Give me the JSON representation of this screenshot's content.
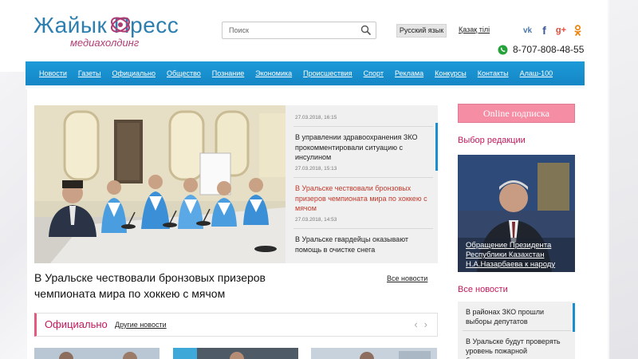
{
  "header": {
    "logo_title": "Жайык Пресс",
    "logo_subtitle": "медиахолдинг",
    "search_placeholder": "Поиск",
    "lang_ru": "Русский язык",
    "lang_kz": "Қазақ тілі",
    "social_icons": [
      "vk-icon",
      "facebook-icon",
      "google-plus-icon",
      "odnoklassniki-icon"
    ],
    "phone": "8-707-808-48-55"
  },
  "nav": {
    "items": [
      "Новости",
      "Газеты",
      "Официально",
      "Общество",
      "Познание",
      "Экономика",
      "Происшествия",
      "Спорт",
      "Реклама",
      "Конкурсы",
      "Контакты",
      "Алаш-100"
    ]
  },
  "slider": {
    "news": [
      {
        "date": "27.03.2018, 16:15"
      },
      {
        "title": "В управлении здравоохранения ЗКО прокомментировали ситуацию с инсулином",
        "date": "27.03.2018, 15:13"
      },
      {
        "title": "В Уральске чествовали бронзовых призеров чемпионата мира по хоккею с мячом",
        "date": "27.03.2018, 14:53"
      },
      {
        "title": "В Уральске гвардейцы оказывают помощь в очистке снега"
      }
    ],
    "headline": "В Уральске чествовали бронзовых призеров чемпионата мира по хоккею с мячом",
    "all_news": "Все новости"
  },
  "official": {
    "title": "Официально",
    "other_news": "Другие новости"
  },
  "sidebar": {
    "online_subscription": "Online подписка",
    "editor_choice_title": "Выбор редакции",
    "editor_caption": "Обращение Президента Республики Казахстан Н.А.Назарбаева к народу",
    "all_news_title": "Все новости",
    "news": [
      "В районах ЗКО прошли выборы депутатов",
      "В Уральске будут проверять уровень пожарной безопасности"
    ]
  },
  "colors": {
    "nav_blue": "#1a8fd0",
    "accent_pink": "#c2185b",
    "button_pink": "#f58ea4",
    "logo_blue": "#2d7fb0"
  }
}
